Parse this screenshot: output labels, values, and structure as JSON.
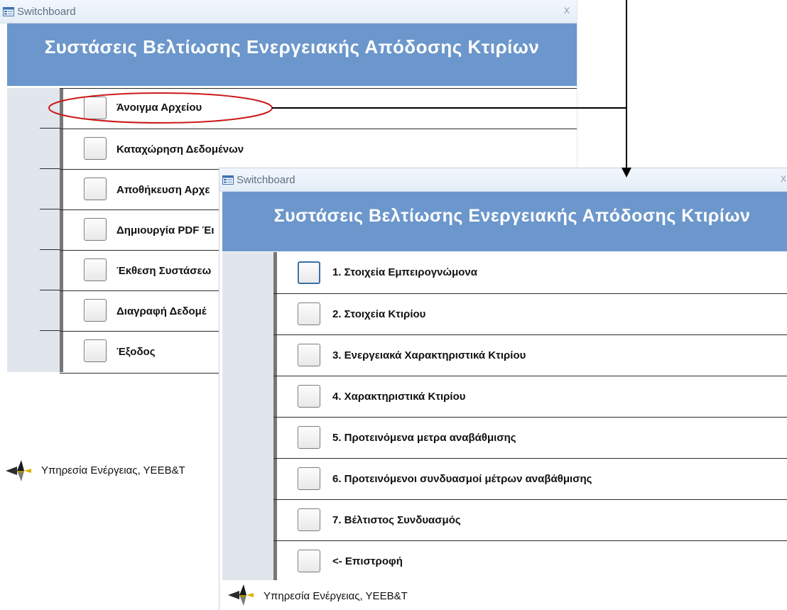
{
  "window_back": {
    "title": "Switchboard",
    "close_glyph": "x",
    "header_title": "Συστάσεις Βελτίωσης Ενεργειακής Απόδοσης Κτιρίων",
    "items": [
      {
        "label": "Άνοιγμα Αρχείου"
      },
      {
        "label": "Καταχώρηση Δεδομένων"
      },
      {
        "label": "Αποθήκευση Αρχε"
      },
      {
        "label": "Δημιουργία PDF Έι"
      },
      {
        "label": "Έκθεση Συστάσεω"
      },
      {
        "label": "Διαγραφή Δεδομέ"
      },
      {
        "label": "Έξοδος"
      }
    ],
    "footer_text": "Υπηρεσία Ενέργειας, ΥΕΕΒ&Τ"
  },
  "window_front": {
    "title": "Switchboard",
    "close_glyph": "x",
    "header_title": "Συστάσεις Βελτίωσης Ενεργειακής Απόδοσης Κτιρίων",
    "items": [
      {
        "label": "1. Στοιχεία Εμπειρογνώμονα"
      },
      {
        "label": "2. Στοιχεία Κτιρίου"
      },
      {
        "label": "3. Ενεργειακά Χαρακτηριστικά Κτιρίου"
      },
      {
        "label": "4. Χαρακτηριστικά Κτιρίου"
      },
      {
        "label": "5. Προτεινόμενα μετρα αναβάθμισης"
      },
      {
        "label": "6. Προτεινόμενοι συνδυασμοί μέτρων αναβάθμισης"
      },
      {
        "label": "7. Βέλτιστος Συνδυασμός"
      },
      {
        "label": "<- Επιστροφή"
      }
    ],
    "footer_text": "Υπηρεσία Ενέργειας, ΥΕΕΒ&Τ"
  },
  "icons": {
    "form": "form-icon",
    "logo": "energy-service-logo-icon",
    "annotation": "annotation-ellipse-arrow"
  },
  "colors": {
    "header_blue": "#6c97cc",
    "annotation_red": "#cc1a1a"
  }
}
